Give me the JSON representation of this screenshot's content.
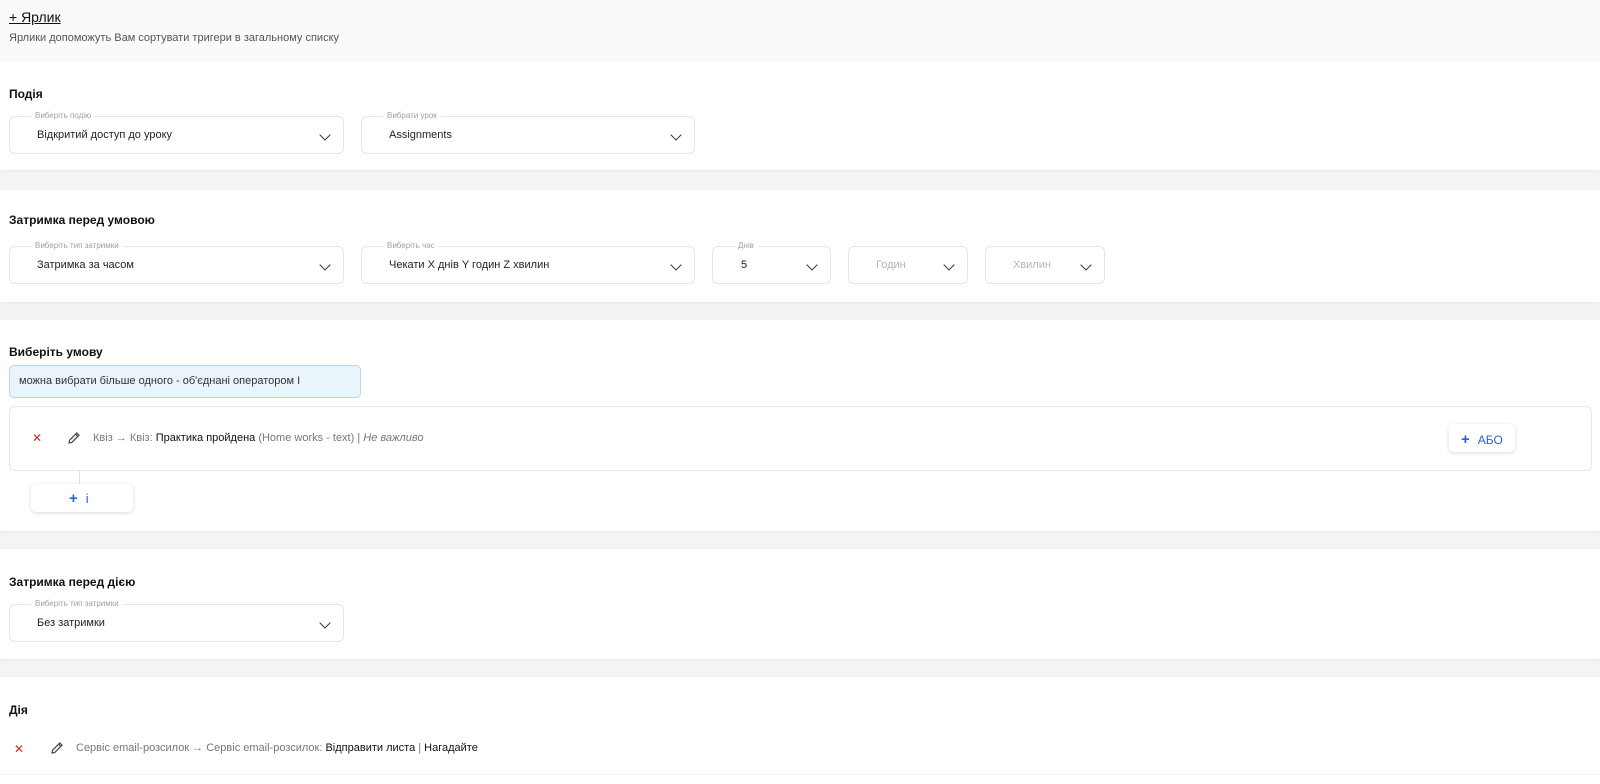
{
  "labels": {
    "add_label": "+ Ярлик",
    "hint": "Ярлики допоможуть Вам сортувати тригери в загальному списку"
  },
  "event": {
    "title": "Подія",
    "event_select": {
      "legend": "Виберіть подію",
      "value": "Відкритий доступ до уроку"
    },
    "lesson_select": {
      "legend": "Вибрати урок",
      "value": "Assignments"
    }
  },
  "delay_condition": {
    "title": "Затримка перед умовою",
    "type_select": {
      "legend": "Виберіть тип затримки",
      "value": "Затримка за часом"
    },
    "time_select": {
      "legend": "Виберіть час",
      "value": "Чекати X днів Y годин Z хвилин"
    },
    "days_select": {
      "legend": "Днів",
      "value": "5"
    },
    "hours_select": {
      "placeholder": "Годин"
    },
    "minutes_select": {
      "placeholder": "Хвилин"
    }
  },
  "condition": {
    "title": "Виберіть умову",
    "hint": "можна вибрати більше одного - об'єднані оператором І",
    "row": {
      "prefix": "Квіз → Квіз: ",
      "strong": "Практика пройдена",
      "middle": " (Home works - text) | ",
      "italic": "Не важливо"
    },
    "or_label": "АБО",
    "and_label": "і"
  },
  "delay_action": {
    "title": "Затримка перед дією",
    "type_select": {
      "legend": "Виберіть тип затримки",
      "value": "Без затримки"
    }
  },
  "action": {
    "title": "Дія",
    "row": {
      "prefix": "Сервіс email-розсилок → Сервіс email-розсилок: ",
      "strong": "Відправити листа",
      "sep": " | ",
      "strong2": "Нагадайте"
    }
  },
  "icons": {
    "remove": "close-icon",
    "edit": "pencil-icon",
    "dropdown": "chevron-down-icon",
    "add": "plus-icon"
  },
  "colors": {
    "remove_icon": "#d02a2a",
    "accent_blue": "#2563d9",
    "hint_bg": "#eaf4fb"
  }
}
